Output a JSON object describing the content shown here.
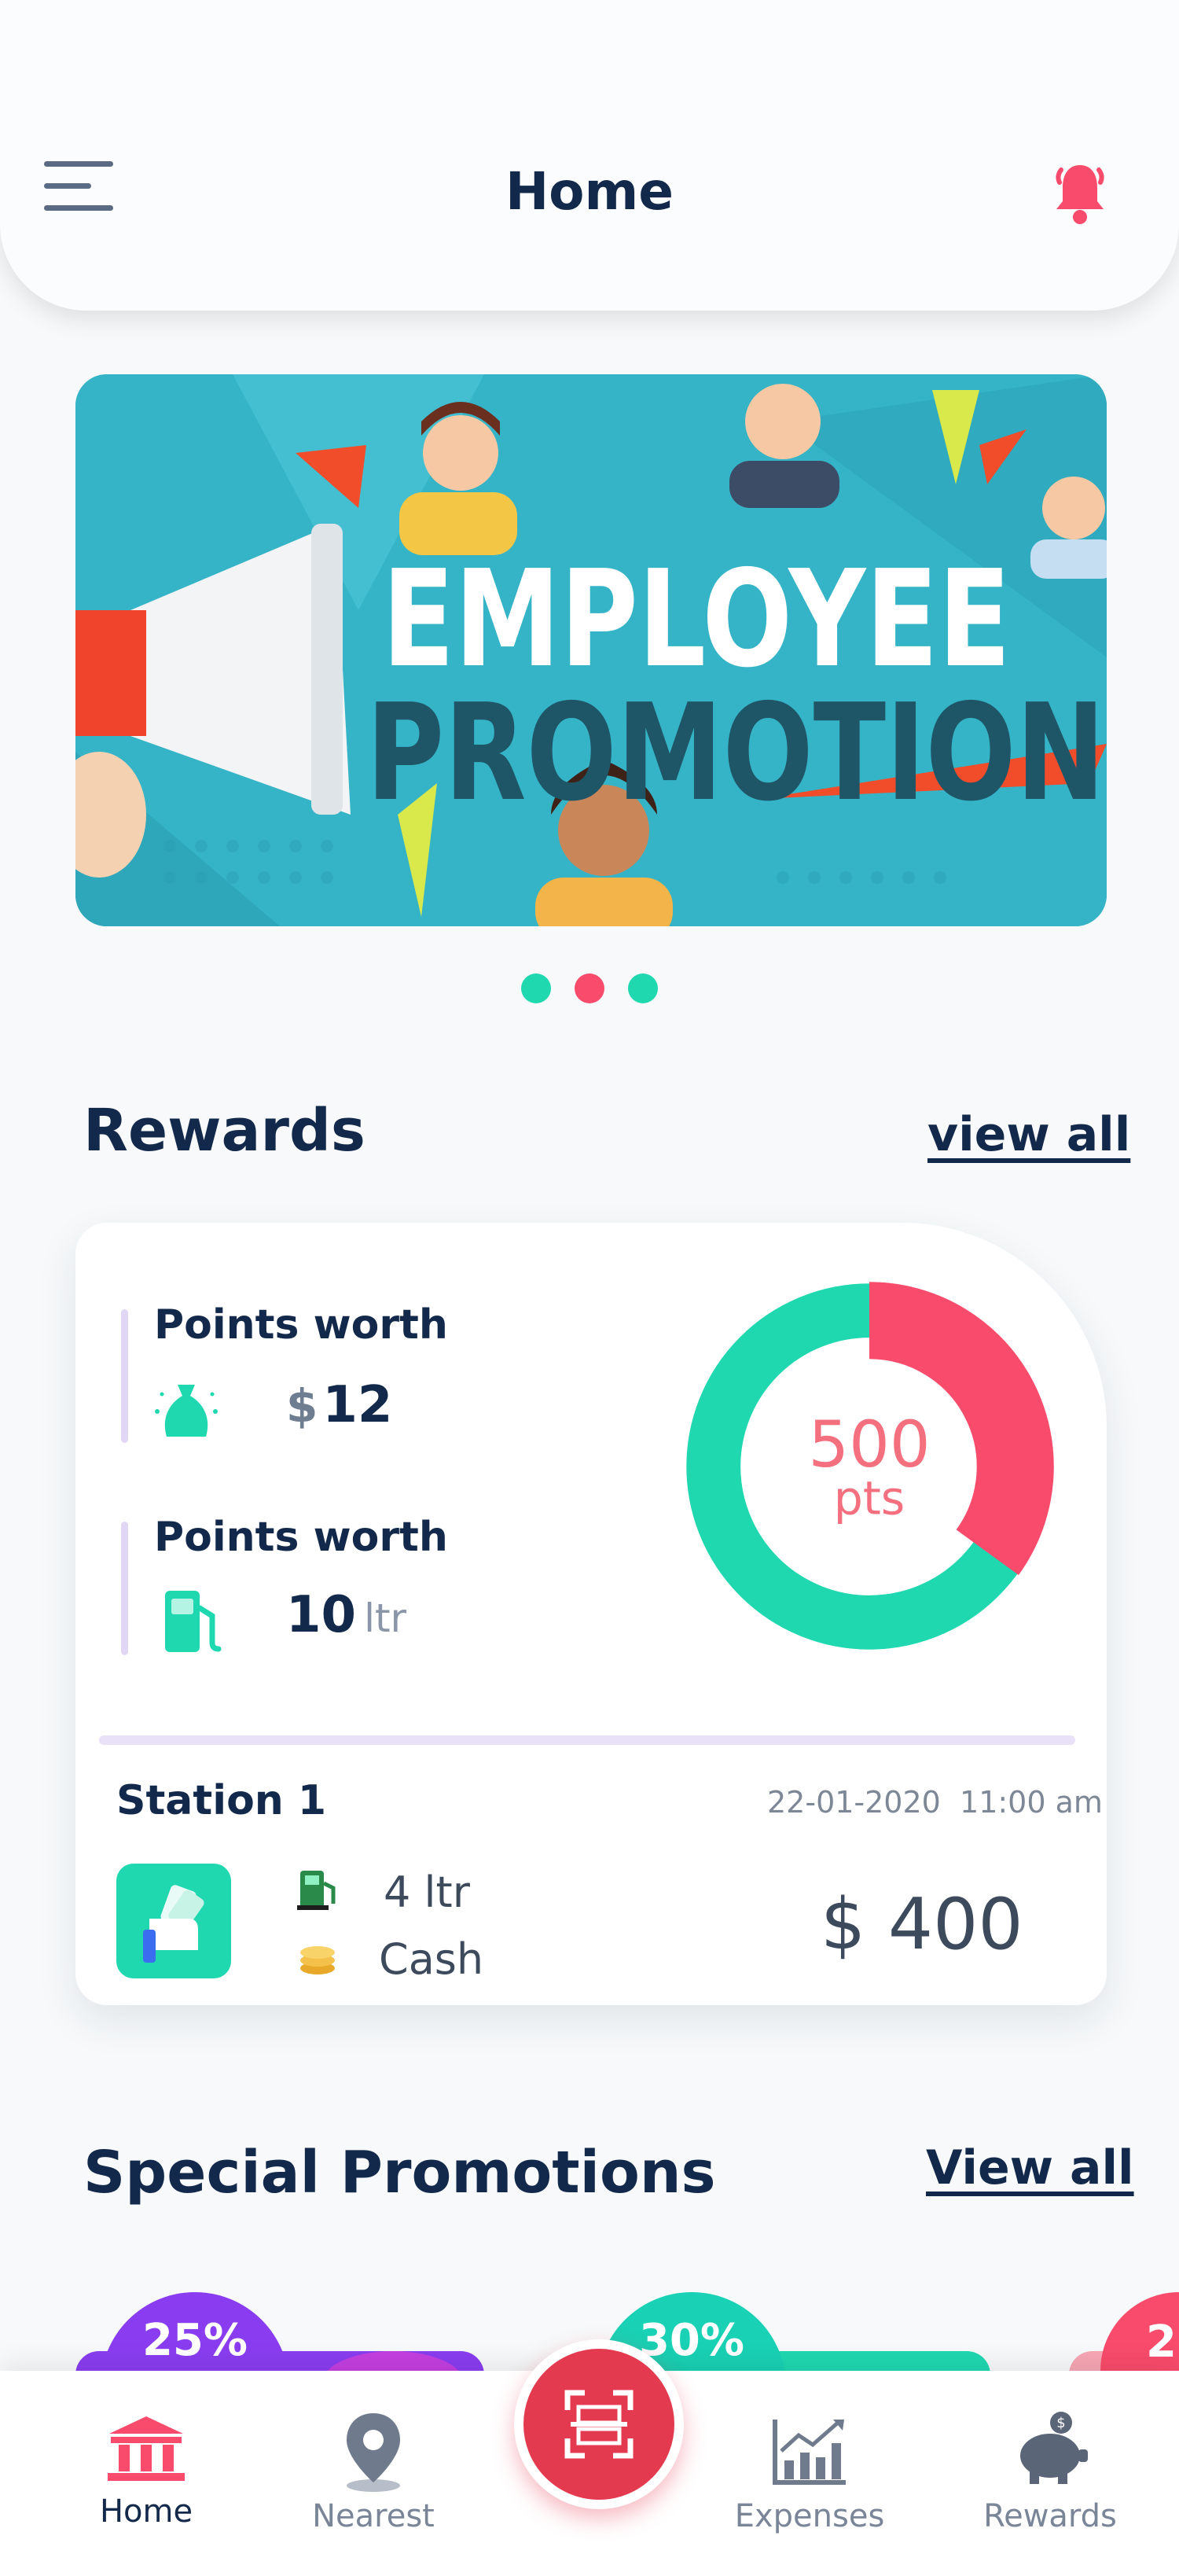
{
  "header": {
    "title": "Home"
  },
  "banner": {
    "line1": "EMPLOYEE",
    "line2": "PROMOTION",
    "slides": 3,
    "active_slide": 2
  },
  "rewards": {
    "title": "Rewards",
    "view_all": "view all",
    "points_money": {
      "label": "Points worth",
      "currency": "$",
      "value": "12"
    },
    "points_fuel": {
      "label": "Points worth",
      "value": "10",
      "unit": "ltr"
    },
    "donut": {
      "value": "500",
      "unit": "pts",
      "highlight_fraction": 0.35
    },
    "transaction": {
      "station": "Station 1",
      "date": "22-01-2020",
      "time": "11:00 am",
      "fuel": "4 ltr",
      "payment": "Cash",
      "amount": "$ 400"
    }
  },
  "promotions": {
    "title": "Special Promotions",
    "view_all": "View all",
    "badges": [
      "25%",
      "30%",
      "2"
    ]
  },
  "nav": {
    "items": [
      {
        "label": "Home",
        "icon": "bank-icon"
      },
      {
        "label": "Nearest",
        "icon": "location-pin-icon"
      },
      {
        "label": "Expenses",
        "icon": "chart-icon"
      },
      {
        "label": "Rewards",
        "icon": "piggy-bank-icon"
      }
    ],
    "active": "Home"
  },
  "colors": {
    "accent_red": "#f94b6b",
    "accent_teal": "#1fd8b0",
    "navy": "#13294b",
    "scan_red": "#e43a4f"
  }
}
